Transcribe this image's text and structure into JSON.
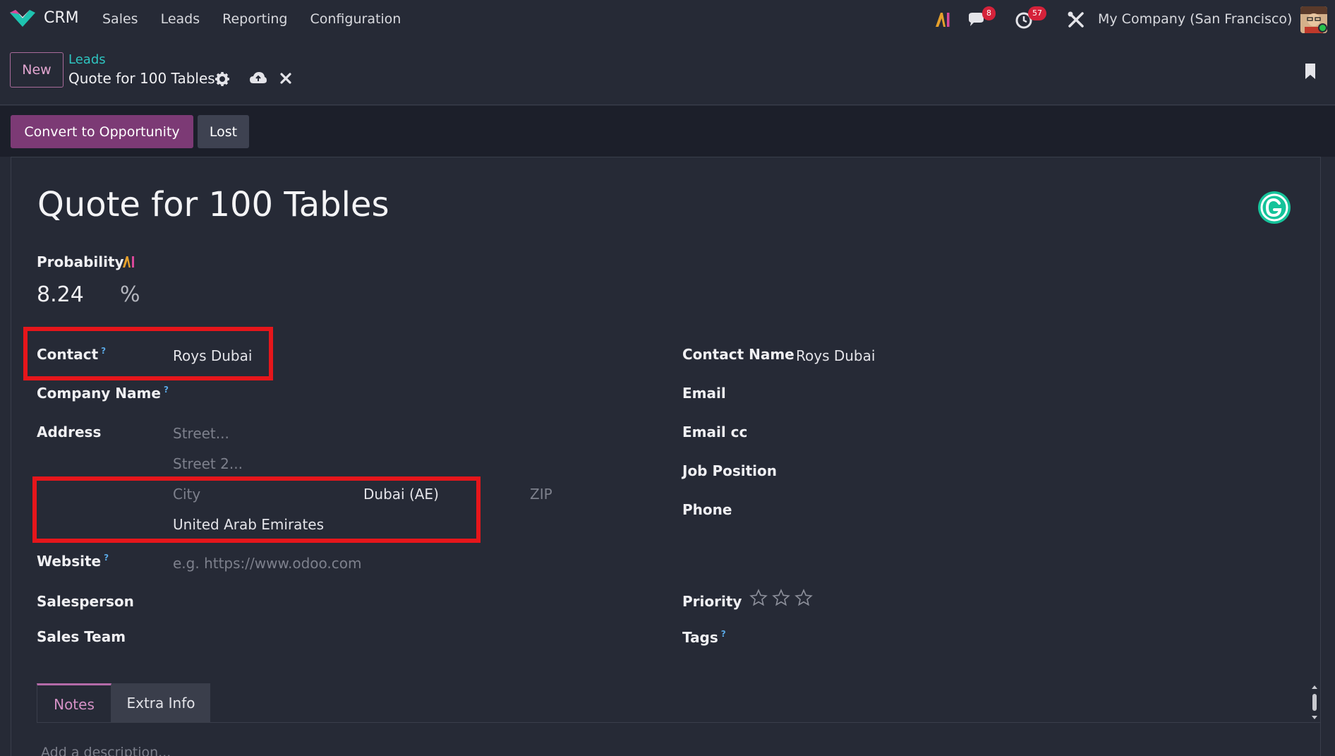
{
  "navbar": {
    "app_name": "CRM",
    "menu": [
      "Sales",
      "Leads",
      "Reporting",
      "Configuration"
    ],
    "messages_badge": "8",
    "activities_badge": "57",
    "company": "My Company (San Francisco)"
  },
  "control_panel": {
    "new_label": "New",
    "breadcrumb": "Leads",
    "record_title": "Quote for 100 Tables"
  },
  "statusbar": {
    "convert_label": "Convert to Opportunity",
    "lost_label": "Lost"
  },
  "form": {
    "title": "Quote for 100 Tables",
    "probability_label": "Probability",
    "probability_value": "8.24",
    "probability_unit": "%",
    "left": {
      "contact_label": "Contact",
      "contact_value": "Roys Dubai",
      "company_name_label": "Company Name",
      "address_label": "Address",
      "street_placeholder": "Street...",
      "street2_placeholder": "Street 2...",
      "city_placeholder": "City",
      "state_value": "Dubai (AE)",
      "zip_placeholder": "ZIP",
      "country_value": "United Arab Emirates",
      "website_label": "Website",
      "website_placeholder": "e.g. https://www.odoo.com",
      "salesperson_label": "Salesperson",
      "sales_team_label": "Sales Team"
    },
    "right": {
      "contact_name_label": "Contact Name",
      "contact_name_value": "Roys Dubai",
      "email_label": "Email",
      "email_cc_label": "Email cc",
      "job_position_label": "Job Position",
      "phone_label": "Phone",
      "priority_label": "Priority",
      "priority_stars": 0,
      "tags_label": "Tags"
    },
    "help_marker": "?",
    "tabs": [
      "Notes",
      "Extra Info"
    ],
    "description_placeholder": "Add a description..."
  },
  "colors": {
    "primary": "#7c3a75",
    "teal_link": "#2ec4c0",
    "highlight_box": "#e6161b",
    "badge": "#d5223a"
  }
}
